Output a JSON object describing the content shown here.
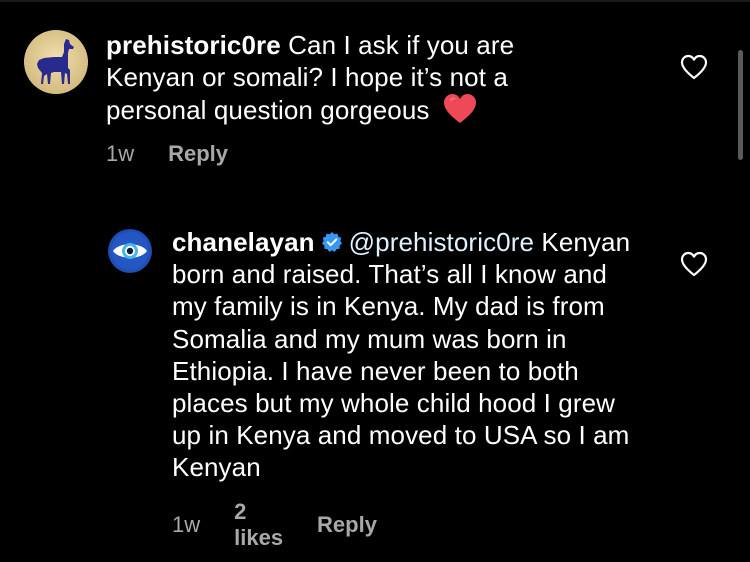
{
  "colors": {
    "background": "#000000",
    "text": "#ffffff",
    "meta": "#a8a8a8",
    "verified": "#3897f0",
    "heart": "#ed4956"
  },
  "comments": [
    {
      "username": "prehistoric0re",
      "text": "Can I ask if you are Kenyan or somali? I hope it’s not a personal question gorgeous",
      "emoji": "heart-emoji",
      "time": "1w",
      "reply_label": "Reply",
      "avatar_icon": "llama-avatar-icon",
      "like_icon": "heart-outline-icon"
    },
    {
      "username": "chanelayan",
      "verified": true,
      "mention": "@prehistoric0re",
      "text": "Kenyan born and raised. That’s all I know and my family is in Kenya. My dad is from Somalia and my mum was born in Ethiopia. I have never been to both places but my whole child hood I grew up in Kenya and moved to USA so I am Kenyan",
      "time": "1w",
      "likes": "2 likes",
      "reply_label": "Reply",
      "avatar_icon": "evil-eye-avatar-icon",
      "like_icon": "heart-outline-icon"
    }
  ]
}
